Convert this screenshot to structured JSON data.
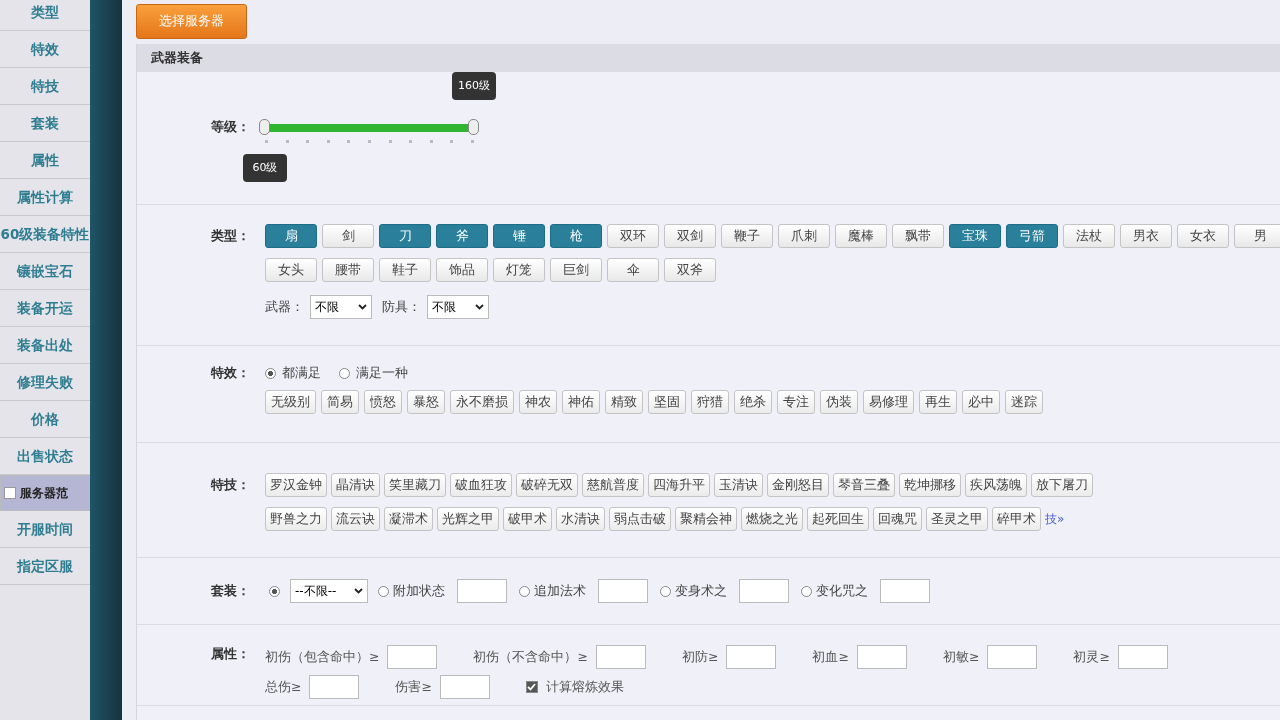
{
  "sidebar": {
    "items": [
      {
        "label": "类型",
        "selected": false
      },
      {
        "label": "特效",
        "selected": false
      },
      {
        "label": "特技",
        "selected": false
      },
      {
        "label": "套装",
        "selected": false
      },
      {
        "label": "属性",
        "selected": false
      },
      {
        "label": "属性计算",
        "selected": false
      },
      {
        "label": "60级装备特性",
        "selected": false
      },
      {
        "label": "镶嵌宝石",
        "selected": false
      },
      {
        "label": "装备开运",
        "selected": false
      },
      {
        "label": "装备出处",
        "selected": false
      },
      {
        "label": "修理失败",
        "selected": false
      },
      {
        "label": "价格",
        "selected": false
      },
      {
        "label": "出售状态",
        "selected": false
      },
      {
        "label": "服务器范",
        "selected": true
      },
      {
        "label": "开服时间",
        "selected": false
      },
      {
        "label": "指定区服",
        "selected": false
      }
    ]
  },
  "server_button": "选择服务器",
  "section_title": "武器装备",
  "level": {
    "label": "等级：",
    "handles": [
      {
        "label": "60级",
        "level": 0
      },
      {
        "label": "160级",
        "level": 1
      }
    ]
  },
  "types": {
    "label": "类型：",
    "rows": [
      [
        {
          "label": "扇",
          "selected": true
        },
        {
          "label": "剑",
          "selected": false
        },
        {
          "label": "刀",
          "selected": true
        },
        {
          "label": "斧",
          "selected": true
        },
        {
          "label": "锤",
          "selected": true
        },
        {
          "label": "枪",
          "selected": true
        },
        {
          "label": "双环",
          "selected": false
        },
        {
          "label": "双剑",
          "selected": false
        },
        {
          "label": "鞭子",
          "selected": false
        },
        {
          "label": "爪刺",
          "selected": false
        },
        {
          "label": "魔棒",
          "selected": false
        },
        {
          "label": "飘带",
          "selected": false
        },
        {
          "label": "宝珠",
          "selected": true
        },
        {
          "label": "弓箭",
          "selected": true
        },
        {
          "label": "法杖",
          "selected": false
        },
        {
          "label": "男衣",
          "selected": false
        },
        {
          "label": "女衣",
          "selected": false
        },
        {
          "label": "男",
          "selected": false
        }
      ],
      [
        {
          "label": "女头",
          "selected": false
        },
        {
          "label": "腰带",
          "selected": false
        },
        {
          "label": "鞋子",
          "selected": false
        },
        {
          "label": "饰品",
          "selected": false
        },
        {
          "label": "灯笼",
          "selected": false
        },
        {
          "label": "巨剑",
          "selected": false
        },
        {
          "label": "伞",
          "selected": false
        },
        {
          "label": "双斧",
          "selected": false
        }
      ]
    ],
    "selects": [
      {
        "label": "武器：",
        "value": "不限"
      },
      {
        "label": "防具：",
        "value": "不限"
      }
    ]
  },
  "effects": {
    "label": "特效：",
    "modes": [
      {
        "label": "都满足",
        "selected": true
      },
      {
        "label": "满足一种",
        "selected": false
      }
    ],
    "options": [
      "无级别",
      "简易",
      "愤怒",
      "暴怒",
      "永不磨损",
      "神农",
      "神佑",
      "精致",
      "坚固",
      "狩猎",
      "绝杀",
      "专注",
      "伪装",
      "易修理",
      "再生",
      "必中",
      "迷踪"
    ]
  },
  "skills": {
    "label": "特技：",
    "options": [
      "罗汉金钟",
      "晶清诀",
      "笑里藏刀",
      "破血狂攻",
      "破碎无双",
      "慈航普度",
      "四海升平",
      "玉清诀",
      "金刚怒目",
      "琴音三叠",
      "乾坤挪移",
      "疾风荡魄",
      "放下屠刀",
      "野兽之力",
      "流云诀",
      "凝滞术",
      "光辉之甲",
      "破甲术",
      "水清诀",
      "弱点击破",
      "聚精会神",
      "燃烧之光",
      "起死回生",
      "回魂咒",
      "圣灵之甲",
      "碎甲术"
    ],
    "more_link": "技»"
  },
  "suit": {
    "label": "套装：",
    "any_selected": true,
    "select_value": "--不限--",
    "options": [
      {
        "label": "附加状态",
        "selected": false
      },
      {
        "label": "追加法术",
        "selected": false
      },
      {
        "label": "变身术之",
        "selected": false
      },
      {
        "label": "变化咒之",
        "selected": false
      }
    ]
  },
  "attributes": {
    "label": "属性：",
    "rows": [
      [
        "初伤（包含命中）≥",
        "初伤（不含命中）≥",
        "初防≥",
        "初血≥",
        "初敏≥",
        "初灵≥"
      ],
      [
        "总伤≥",
        "伤害≥"
      ]
    ],
    "smelt": {
      "label": "计算熔炼效果",
      "checked": true
    }
  }
}
